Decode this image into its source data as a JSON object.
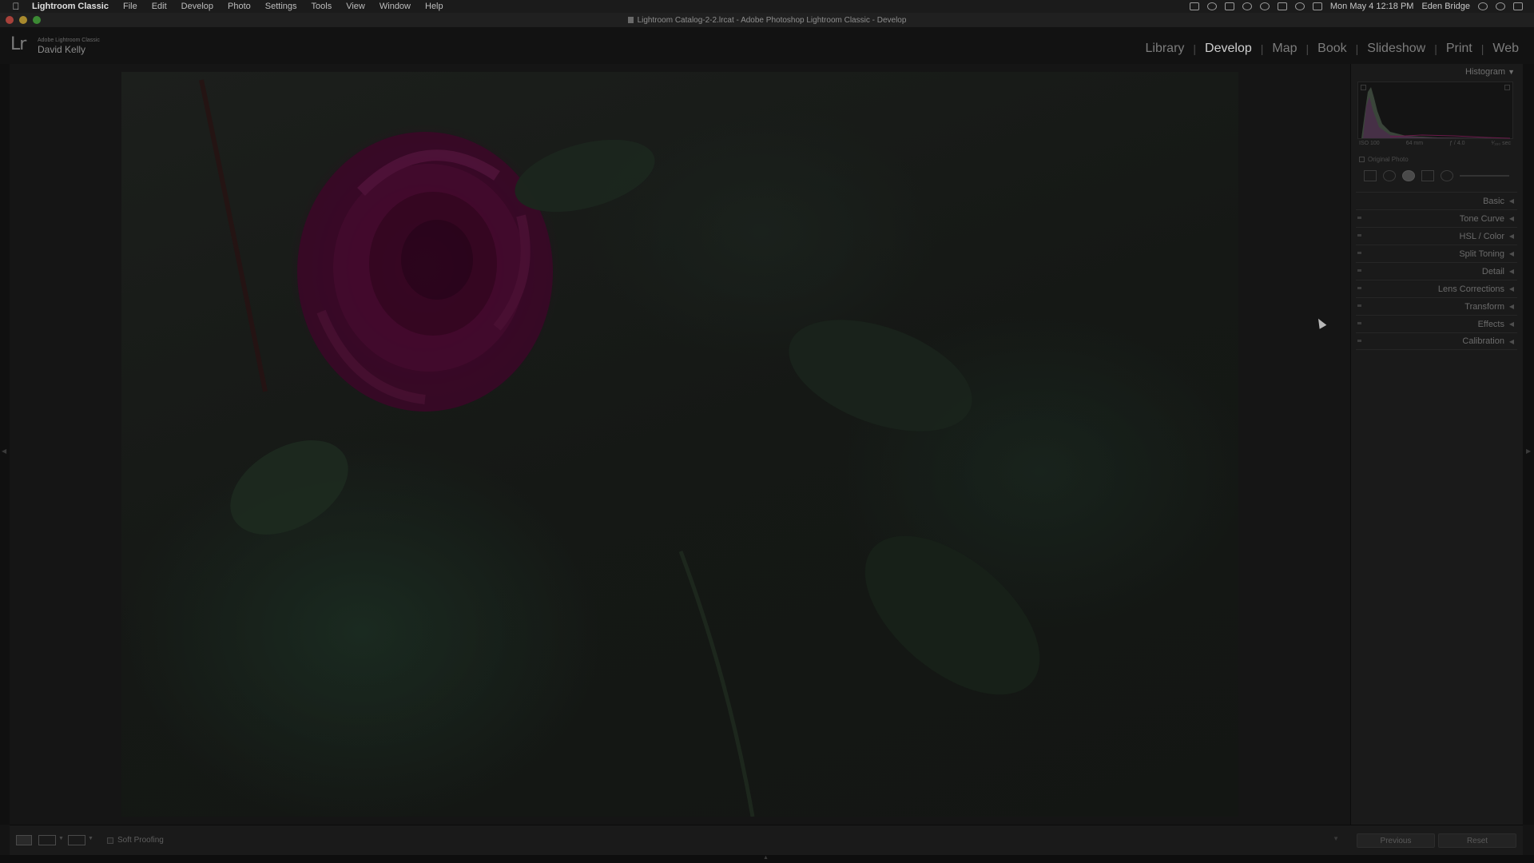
{
  "menubar": {
    "app_name": "Lightroom Classic",
    "items": [
      "File",
      "Edit",
      "Develop",
      "Photo",
      "Settings",
      "Tools",
      "View",
      "Window",
      "Help"
    ],
    "clock": "Mon May 4  12:18 PM",
    "user": "Eden Bridge"
  },
  "window": {
    "title": "Lightroom Catalog-2-2.lrcat - Adobe Photoshop Lightroom Classic - Develop"
  },
  "identity": {
    "logo": "Lr",
    "product": "Adobe Lightroom Classic",
    "user": "David Kelly"
  },
  "modules": {
    "items": [
      "Library",
      "Develop",
      "Map",
      "Book",
      "Slideshow",
      "Print",
      "Web"
    ],
    "active": "Develop"
  },
  "right_panel": {
    "histogram_label": "Histogram",
    "histo_meta": [
      "ISO 100",
      "64 mm",
      "ƒ / 4.0",
      "¹⁄₁₆₀ sec"
    ],
    "original_photo": "Original Photo",
    "sections": [
      "Basic",
      "Tone Curve",
      "HSL / Color",
      "Split Toning",
      "Detail",
      "Lens Corrections",
      "Transform",
      "Effects",
      "Calibration"
    ]
  },
  "bottom": {
    "soft_proofing": "Soft Proofing",
    "previous": "Previous",
    "reset": "Reset"
  },
  "colors": {
    "accent": "#cfcfcf",
    "rose": "#3e0a2a",
    "panel": "#1a1a1a"
  }
}
